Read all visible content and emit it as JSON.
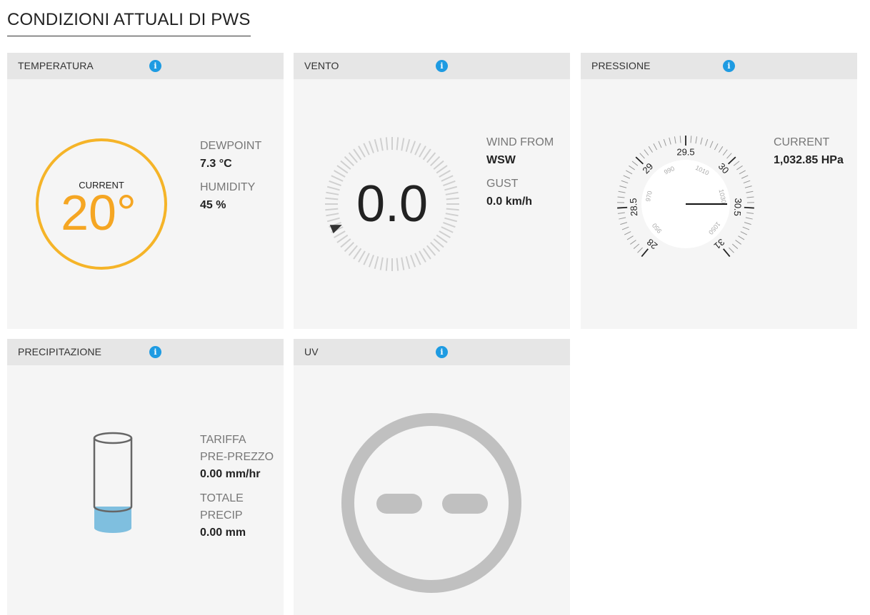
{
  "page": {
    "title": "CONDIZIONI ATTUALI DI PWS"
  },
  "info_glyph": "i",
  "colors": {
    "accent_orange": "#f5a623",
    "info_blue": "#1e9be2",
    "rain_fill": "#7fbfdf",
    "uv_gray": "#c0c0c0"
  },
  "temperature": {
    "title": "TEMPERATURA",
    "current_label": "CURRENT",
    "current_value": "20°",
    "dewpoint_label": "DEWPOINT",
    "dewpoint_value": "7.3 °C",
    "humidity_label": "HUMIDITY",
    "humidity_value": "45 %"
  },
  "wind": {
    "title": "VENTO",
    "speed_value": "0.0",
    "wind_from_label": "WIND FROM",
    "wind_from_value": "WSW",
    "gust_label": "GUST",
    "gust_value": "0.0 km/h",
    "direction_deg": 247.5
  },
  "pressure": {
    "title": "PRESSIONE",
    "current_label": "CURRENT",
    "current_value": "1,032.85 HPa",
    "outer_scale_labels": [
      "28",
      "28.5",
      "29",
      "29.5",
      "30",
      "30.5",
      "31"
    ],
    "inner_scale_labels": [
      "950",
      "970",
      "990",
      "1010",
      "1030",
      "1050"
    ]
  },
  "precipitation": {
    "title": "PRECIPITAZIONE",
    "rate_label_line1": "TARIFFA",
    "rate_label_line2": "PRE-PREZZO",
    "rate_value": "0.00 mm/hr",
    "total_label_line1": "TOTALE",
    "total_label_line2": "PRECIP",
    "total_value": "0.00 mm"
  },
  "uv": {
    "title": "UV"
  }
}
